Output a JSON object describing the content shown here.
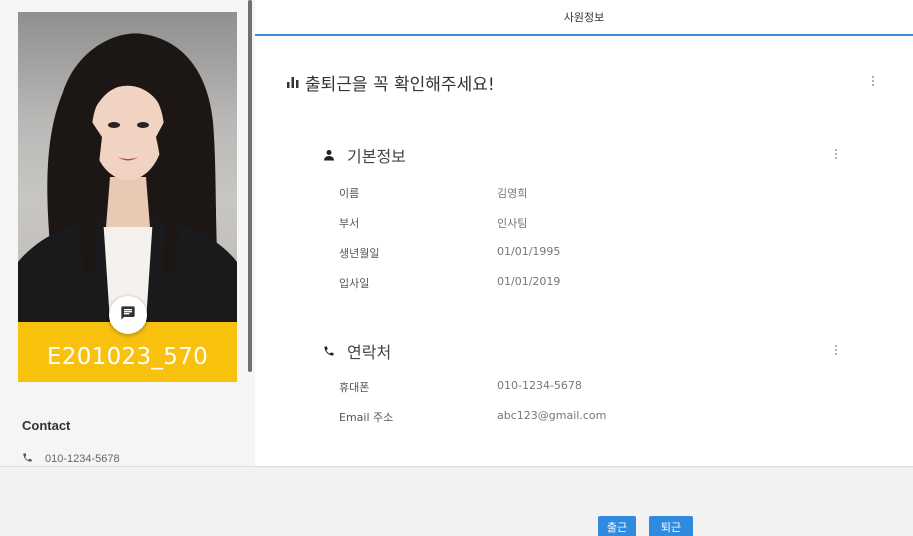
{
  "header": {
    "title": "사원정보"
  },
  "profile": {
    "employee_id": "E201023_570",
    "contact_title": "Contact",
    "contact_phone": "010-1234-5678"
  },
  "headline": {
    "text": "출퇴근을 꼭 확인해주세요!"
  },
  "basic_info": {
    "title": "기본정보",
    "rows": [
      {
        "label": "이름",
        "value": "김영희"
      },
      {
        "label": "부서",
        "value": "인사팀"
      },
      {
        "label": "생년월일",
        "value": "01/01/1995"
      },
      {
        "label": "입사일",
        "value": "01/01/2019"
      }
    ]
  },
  "contact_info": {
    "title": "연락처",
    "rows": [
      {
        "label": "휴대폰",
        "value": "010-1234-5678"
      },
      {
        "label": "Email 주소",
        "value": "abc123@gmail.com"
      }
    ]
  },
  "actions": {
    "clock_in": "출근",
    "clock_out": "퇴근"
  },
  "colors": {
    "accent": "#3b8fd9",
    "banner": "#f7c10d",
    "button": "#2f8ae0"
  },
  "icons": [
    "chat-icon",
    "phone-icon",
    "bar-chart-icon",
    "person-icon",
    "more-vert-icon"
  ]
}
